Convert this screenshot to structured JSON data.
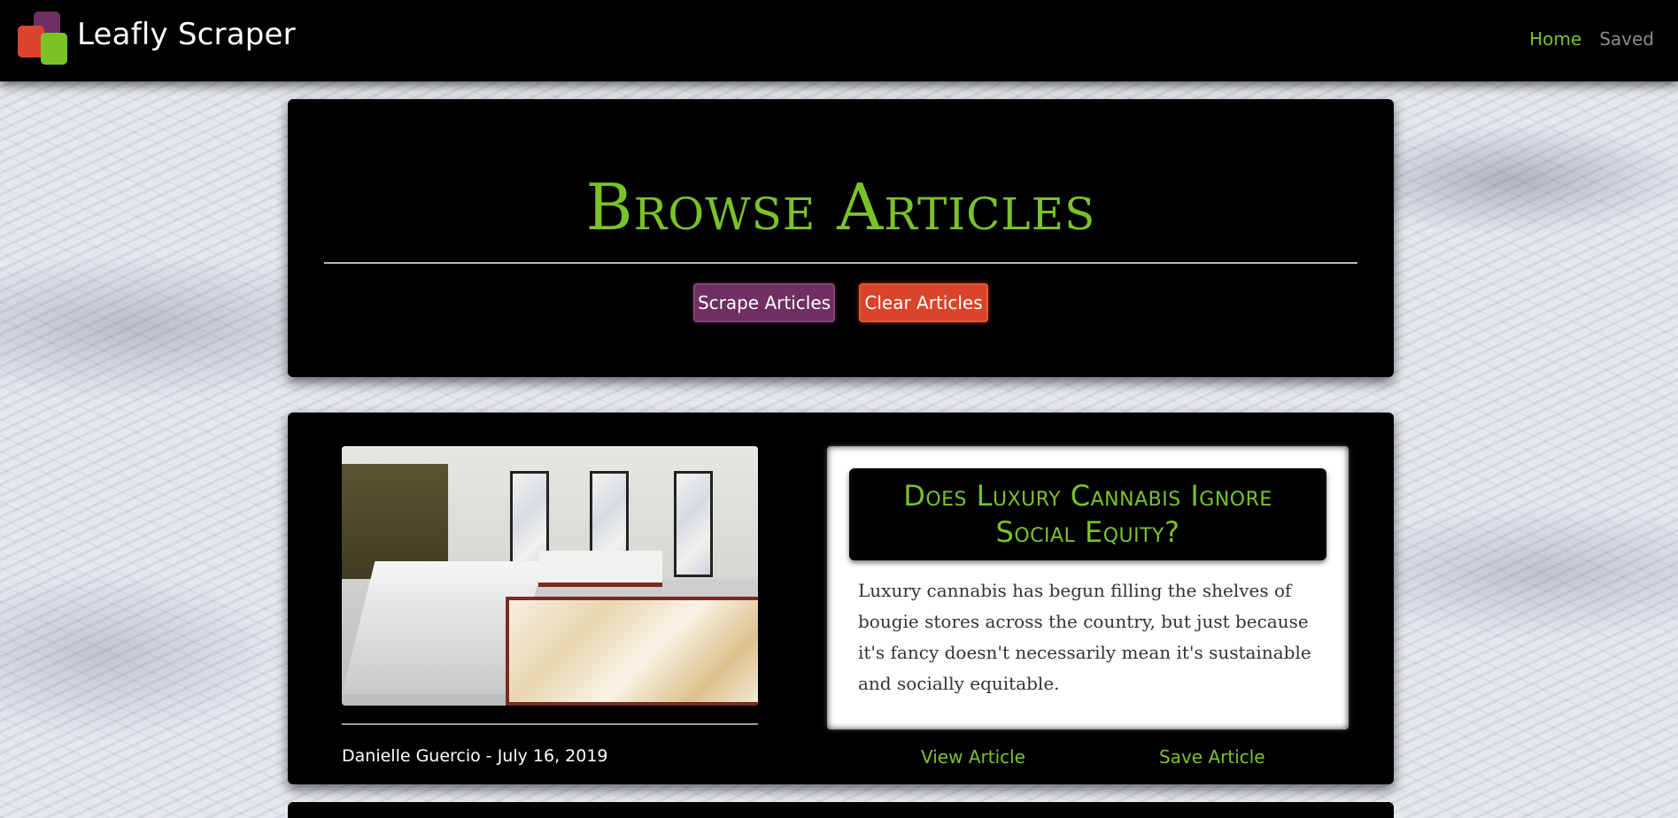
{
  "navbar": {
    "brand": "Leafly Scraper",
    "links": [
      "Home",
      "Saved"
    ]
  },
  "header": {
    "title": "Browse Articles",
    "scrape_label": "Scrape Articles",
    "clear_label": "Clear Articles"
  },
  "articles": [
    {
      "title": "Does Luxury Cannabis Ignore Social Equity?",
      "summary": "Luxury cannabis has begun filling the shelves of bougie stores across the country, but just because it's fancy doesn't necessarily mean it's sustainable and socially equitable.",
      "byline": "Danielle Guercio - July 16, 2019",
      "view_label": "View Article",
      "save_label": "Save Article"
    }
  ],
  "colors": {
    "accent_green": "#7bc22a",
    "purple": "#6e2f63",
    "orange_red": "#d9442a",
    "muted_link": "#8c8c8c"
  },
  "icons": [
    "app-logo-icon"
  ]
}
